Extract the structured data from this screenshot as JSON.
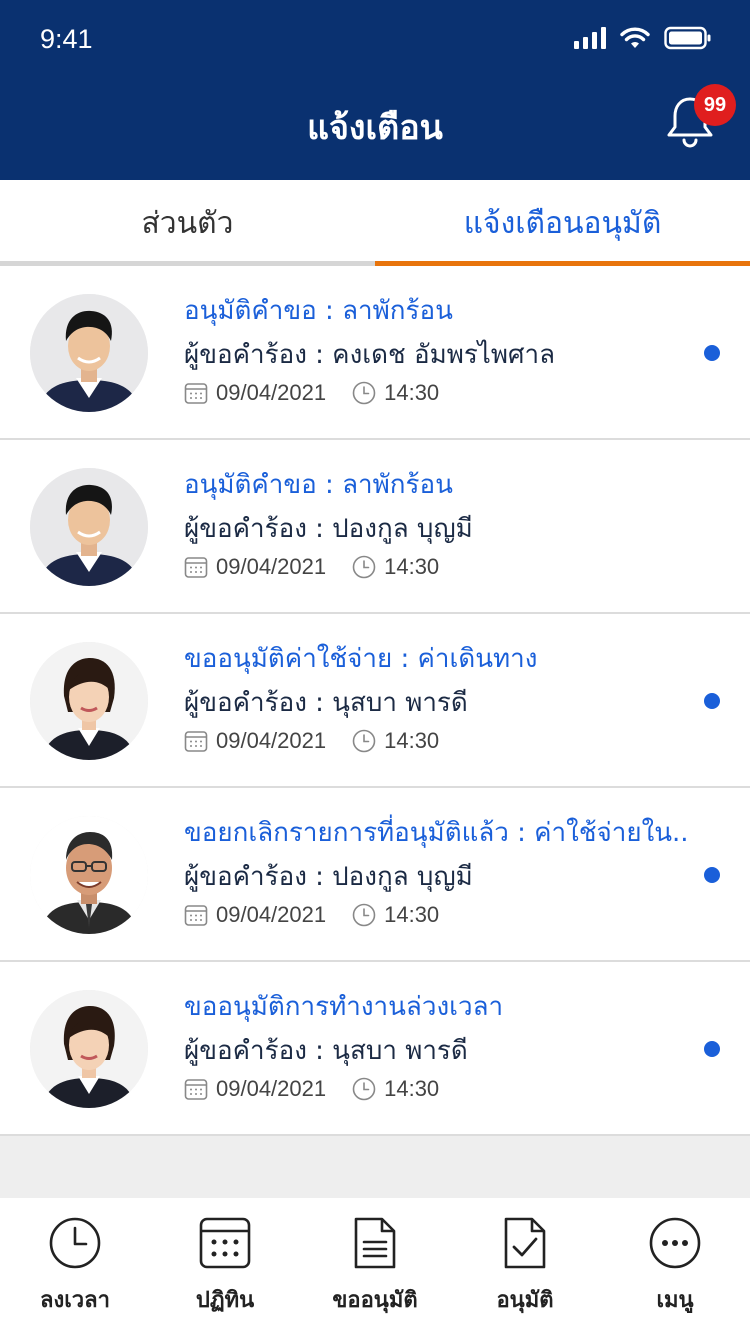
{
  "status_bar": {
    "time": "9:41"
  },
  "header": {
    "title": "แจ้งเตือน",
    "badge_count": "99"
  },
  "tabs": [
    {
      "label": "ส่วนตัว",
      "active": false
    },
    {
      "label": "แจ้งเตือนอนุมัติ",
      "active": true
    }
  ],
  "notifications": [
    {
      "title": "อนุมัติคำขอ : ลาพักร้อน",
      "requester": "ผู้ขอคำร้อง : คงเดช อัมพรไพศาล",
      "date": "09/04/2021",
      "time": "14:30",
      "unread": true,
      "avatar": "young-man"
    },
    {
      "title": "อนุมัติคำขอ : ลาพักร้อน",
      "requester": "ผู้ขอคำร้อง : ปองกูล บุญมี",
      "date": "09/04/2021",
      "time": "14:30",
      "unread": false,
      "avatar": "young-man"
    },
    {
      "title": "ขออนุมัติค่าใช้จ่าย : ค่าเดินทาง",
      "requester": "ผู้ขอคำร้อง : นุสบา พารดี",
      "date": "09/04/2021",
      "time": "14:30",
      "unread": true,
      "avatar": "woman"
    },
    {
      "title": "ขอยกเลิกรายการที่อนุมัติแล้ว : ค่าใช้จ่ายใน..",
      "requester": "ผู้ขอคำร้อง : ปองกูล บุญมี",
      "date": "09/04/2021",
      "time": "14:30",
      "unread": true,
      "avatar": "older-man"
    },
    {
      "title": "ขออนุมัติการทำงานล่วงเวลา",
      "requester": "ผู้ขอคำร้อง : นุสบา พารดี",
      "date": "09/04/2021",
      "time": "14:30",
      "unread": true,
      "avatar": "woman"
    }
  ],
  "bottom_nav": [
    {
      "label": "ลงเวลา",
      "icon": "clock-icon"
    },
    {
      "label": "ปฏิทิน",
      "icon": "calendar-icon"
    },
    {
      "label": "ขออนุมัติ",
      "icon": "document-icon"
    },
    {
      "label": "อนุมัติ",
      "icon": "approve-document-icon"
    },
    {
      "label": "เมนู",
      "icon": "more-icon"
    }
  ],
  "colors": {
    "header_bg": "#0a3170",
    "accent_blue": "#1a5fd9",
    "tab_underline": "#e8740c",
    "badge": "#e01e1e"
  }
}
